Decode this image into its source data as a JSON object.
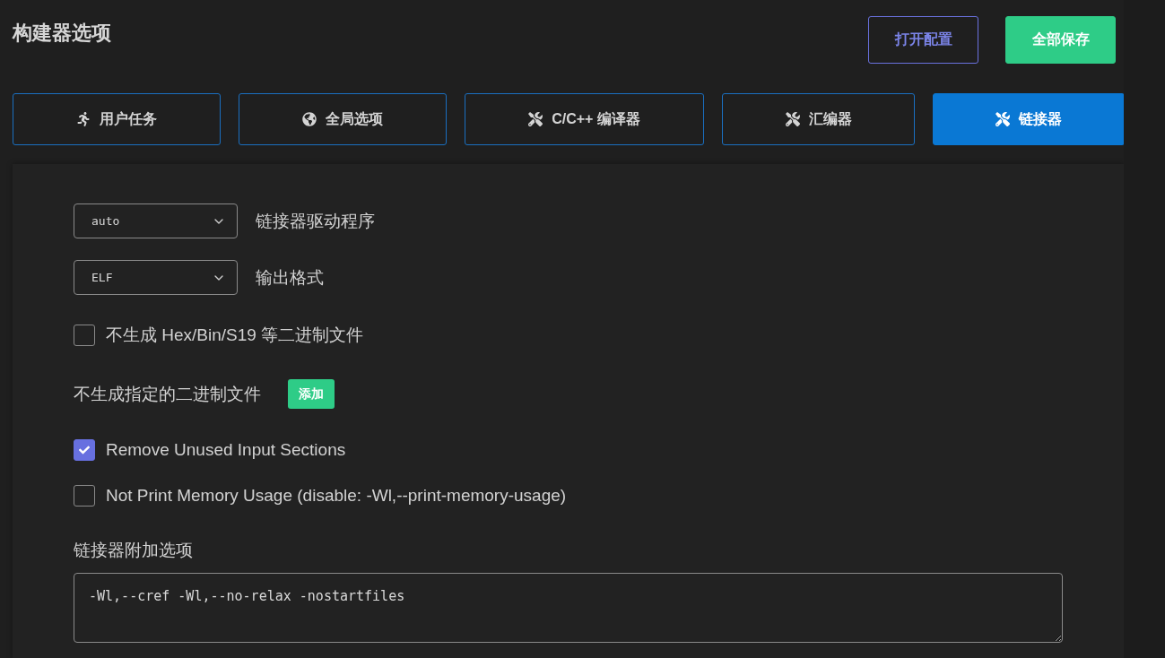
{
  "title": "构建器选项",
  "header_buttons": [
    {
      "label": "打开配置",
      "kind": "outline"
    },
    {
      "label": "全部保存",
      "kind": "primary"
    }
  ],
  "tabs": [
    {
      "label": "用户任务",
      "kind": "task",
      "selected": false
    },
    {
      "label": "全局选项",
      "kind": "global",
      "selected": false
    },
    {
      "label": "C/C++ 编译器",
      "kind": "tool",
      "selected": false
    },
    {
      "label": "汇编器",
      "kind": "tool",
      "selected": false
    },
    {
      "label": "链接器",
      "kind": "tool",
      "selected": true
    }
  ],
  "form": [
    {
      "kind": "select",
      "value": "auto",
      "label": "链接器驱动程序"
    },
    {
      "kind": "select",
      "value": "ELF",
      "label": "输出格式"
    },
    {
      "kind": "checkbox",
      "label": "不生成 Hex/Bin/S19 等二进制文件",
      "checked": false
    },
    {
      "kind": "add",
      "label": "不生成指定的二进制文件",
      "button": "添加"
    },
    {
      "kind": "checkbox",
      "label": "Remove Unused Input Sections",
      "checked": true
    },
    {
      "kind": "checkbox",
      "label": "Not Print Memory Usage (disable: -Wl,--print-memory-usage)",
      "checked": false
    },
    {
      "kind": "textarea",
      "label": "链接器附加选项",
      "value": "-Wl,--cref -Wl,--no-relax -nostartfiles"
    }
  ]
}
